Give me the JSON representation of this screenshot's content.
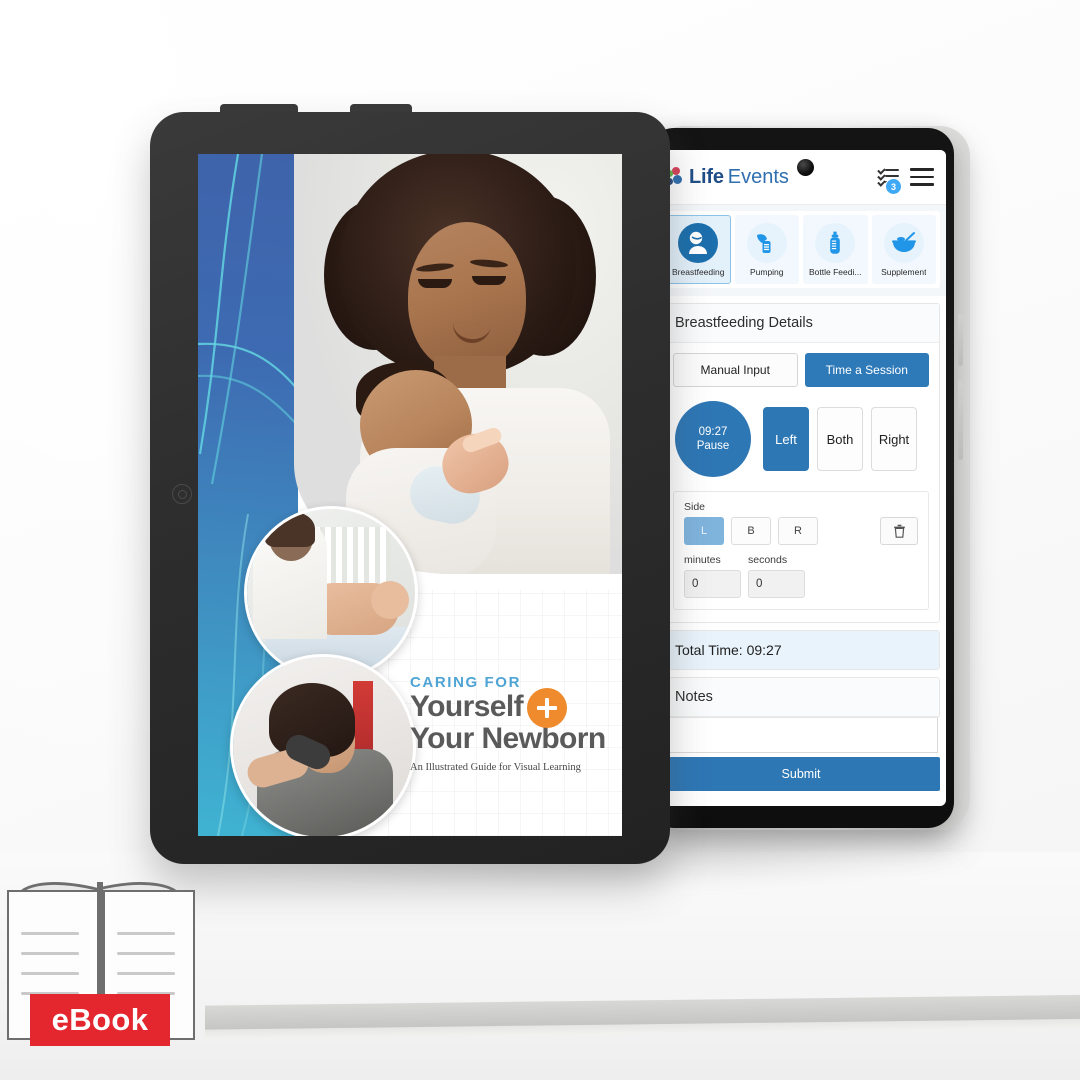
{
  "app": {
    "logo": {
      "primary": "Life",
      "secondary": "Events",
      "mark": "life-events-dots-logo"
    },
    "header_icons": {
      "checklist": "checklist-icon",
      "badge_count": "3",
      "menu": "hamburger-menu-icon"
    },
    "tabs": [
      {
        "label": "Breastfeeding",
        "icon": "breastfeeding-icon",
        "active": true
      },
      {
        "label": "Pumping",
        "icon": "breast-pump-icon",
        "active": false
      },
      {
        "label": "Bottle Feedi...",
        "icon": "baby-bottle-icon",
        "active": false
      },
      {
        "label": "Supplement",
        "icon": "bowl-spoon-icon",
        "active": false
      }
    ],
    "details": {
      "title": "Breastfeeding Details",
      "mode_manual": "Manual Input",
      "mode_timer": "Time a Session",
      "timer_value": "09:27",
      "timer_action": "Pause",
      "side_buttons": [
        {
          "label": "Left",
          "active": true
        },
        {
          "label": "Both",
          "active": false
        },
        {
          "label": "Right",
          "active": false
        }
      ]
    },
    "entry": {
      "side_label": "Side",
      "side_short": [
        {
          "label": "L",
          "active": true
        },
        {
          "label": "B",
          "active": false
        },
        {
          "label": "R",
          "active": false
        }
      ],
      "delete_icon": "trash-icon",
      "minutes_label": "minutes",
      "minutes_value": "0",
      "seconds_label": "seconds",
      "seconds_value": "0"
    },
    "total_time": "Total Time: 09:27",
    "notes_label": "Notes",
    "notes_value": "",
    "submit_label": "Submit"
  },
  "ebook": {
    "kicker": "CARING FOR",
    "title_line1": "Yourself",
    "title_line2": "Your Newborn",
    "subtitle": "An Illustrated Guide for Visual Learning",
    "plus_icon": "plus-icon",
    "badge_label": "eBook"
  },
  "colors": {
    "accent_blue": "#2e77b5",
    "light_blue": "#3fa9f5",
    "cover_blue": "#3e63ab",
    "cover_teal": "#3fb3d2",
    "orange": "#ef8b2c",
    "badge_red": "#e4262f"
  }
}
